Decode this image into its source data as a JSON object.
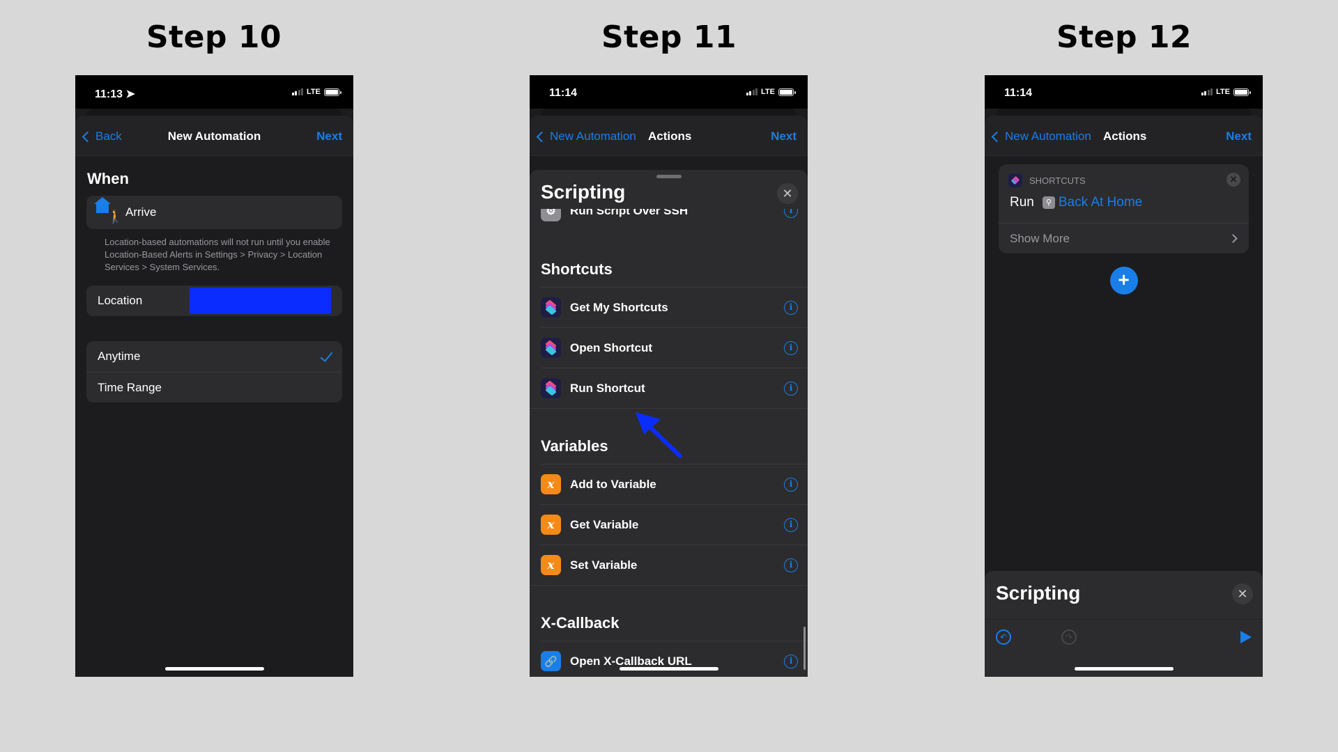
{
  "steps": [
    {
      "title": "Step 10",
      "status": {
        "time": "11:13",
        "location_icon": "location-arrow-icon",
        "network": "LTE"
      },
      "nav": {
        "back": "Back",
        "title": "New Automation",
        "next": "Next"
      },
      "section_title": "When",
      "trigger": {
        "icon": "arrive-location-icon",
        "label": "Arrive"
      },
      "note": "Location-based automations will not run until you enable Location-Based Alerts in Settings > Privacy > Location Services > System Services.",
      "location": {
        "label": "Location",
        "value_redacted": true,
        "redaction_color": "#0a2cff"
      },
      "time_options": [
        {
          "label": "Anytime",
          "selected": true
        },
        {
          "label": "Time Range",
          "selected": false
        }
      ]
    },
    {
      "title": "Step 11",
      "status": {
        "time": "11:14",
        "network": "LTE"
      },
      "nav": {
        "back": "New Automation",
        "title": "Actions",
        "next": "Next"
      },
      "sheet": {
        "title": "Scripting",
        "partial_item": {
          "label": "Run Script Over SSH",
          "icon": "gear-terminal-icon"
        },
        "sections": [
          {
            "header": "Shortcuts",
            "items": [
              {
                "label": "Get My Shortcuts",
                "icon": "shortcuts-icon"
              },
              {
                "label": "Open Shortcut",
                "icon": "shortcuts-icon"
              },
              {
                "label": "Run Shortcut",
                "icon": "shortcuts-icon",
                "highlighted": true
              }
            ]
          },
          {
            "header": "Variables",
            "items": [
              {
                "label": "Add to Variable",
                "icon": "variable-icon"
              },
              {
                "label": "Get Variable",
                "icon": "variable-icon"
              },
              {
                "label": "Set Variable",
                "icon": "variable-icon"
              }
            ]
          },
          {
            "header": "X-Callback",
            "items": [
              {
                "label": "Open X-Callback URL",
                "icon": "link-icon"
              }
            ]
          }
        ]
      },
      "annotation": {
        "type": "arrow",
        "color": "#0a2cff",
        "points_to": "Run Shortcut"
      }
    },
    {
      "title": "Step 12",
      "status": {
        "time": "11:14",
        "network": "LTE"
      },
      "nav": {
        "back": "New Automation",
        "title": "Actions",
        "next": "Next"
      },
      "action_card": {
        "app": "SHORTCUTS",
        "verb": "Run",
        "shortcut_name": "Back At Home",
        "show_more": "Show More"
      },
      "bottom_sheet": {
        "title": "Scripting"
      }
    }
  ],
  "colors": {
    "accent": "#1a7ee8",
    "background": "#d8d8d8",
    "phone_bg": "#1c1c1e",
    "cell_bg": "#2c2c2e",
    "variable_orange": "#f48a17"
  }
}
